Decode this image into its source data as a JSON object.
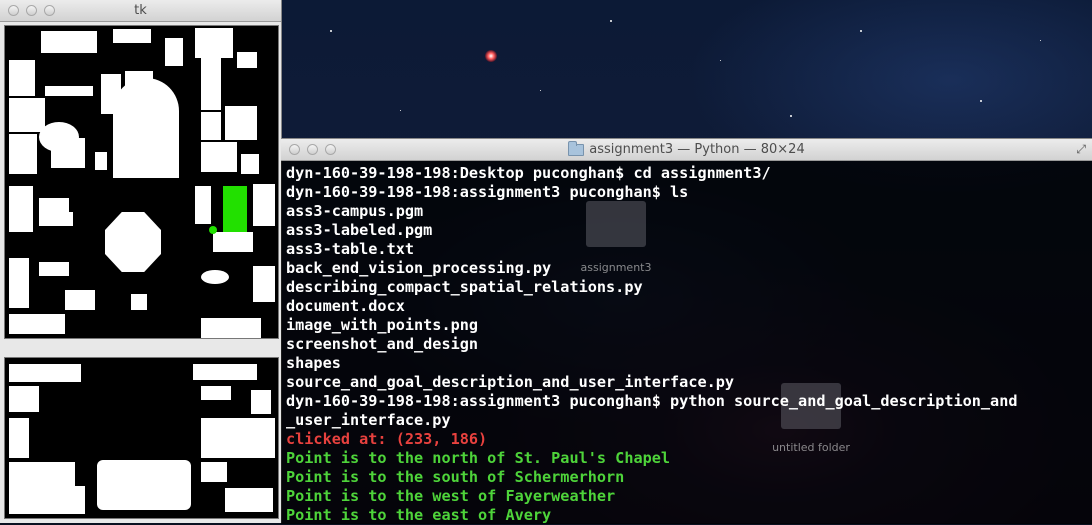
{
  "tk_window": {
    "title": "tk"
  },
  "terminal": {
    "title": "assignment3 — Python — 80×24",
    "lines": [
      {
        "text": "dyn-160-39-198-198:Desktop puconghan$ cd assignment3/",
        "color": "#ffffff"
      },
      {
        "text": "dyn-160-39-198-198:assignment3 puconghan$ ls",
        "color": "#ffffff"
      },
      {
        "text": "ass3-campus.pgm",
        "color": "#ffffff"
      },
      {
        "text": "ass3-labeled.pgm",
        "color": "#ffffff"
      },
      {
        "text": "ass3-table.txt",
        "color": "#ffffff"
      },
      {
        "text": "back_end_vision_processing.py",
        "color": "#ffffff"
      },
      {
        "text": "describing_compact_spatial_relations.py",
        "color": "#ffffff"
      },
      {
        "text": "document.docx",
        "color": "#ffffff"
      },
      {
        "text": "image_with_points.png",
        "color": "#ffffff"
      },
      {
        "text": "screenshot_and_design",
        "color": "#ffffff"
      },
      {
        "text": "shapes",
        "color": "#ffffff"
      },
      {
        "text": "source_and_goal_description_and_user_interface.py",
        "color": "#ffffff"
      },
      {
        "text": "dyn-160-39-198-198:assignment3 puconghan$ python source_and_goal_description_and",
        "color": "#ffffff"
      },
      {
        "text": "_user_interface.py",
        "color": "#ffffff"
      },
      {
        "text": "clicked at: (233, 186)",
        "color": "#e8413e"
      },
      {
        "text": "Point is to the north of St. Paul's Chapel",
        "color": "#4ed43a"
      },
      {
        "text": "Point is to the south of Schermerhorn",
        "color": "#4ed43a"
      },
      {
        "text": "Point is to the west of Fayerweather",
        "color": "#4ed43a"
      },
      {
        "text": "Point is to the east of Avery",
        "color": "#4ed43a"
      }
    ]
  },
  "desktop": {
    "folders": [
      {
        "label": "assignment3"
      },
      {
        "label": "untitled folder"
      }
    ]
  },
  "colors": {
    "highlight_green": "#22e000",
    "prompt_white": "#ffffff",
    "error_red": "#e8413e",
    "result_green": "#4ed43a"
  }
}
